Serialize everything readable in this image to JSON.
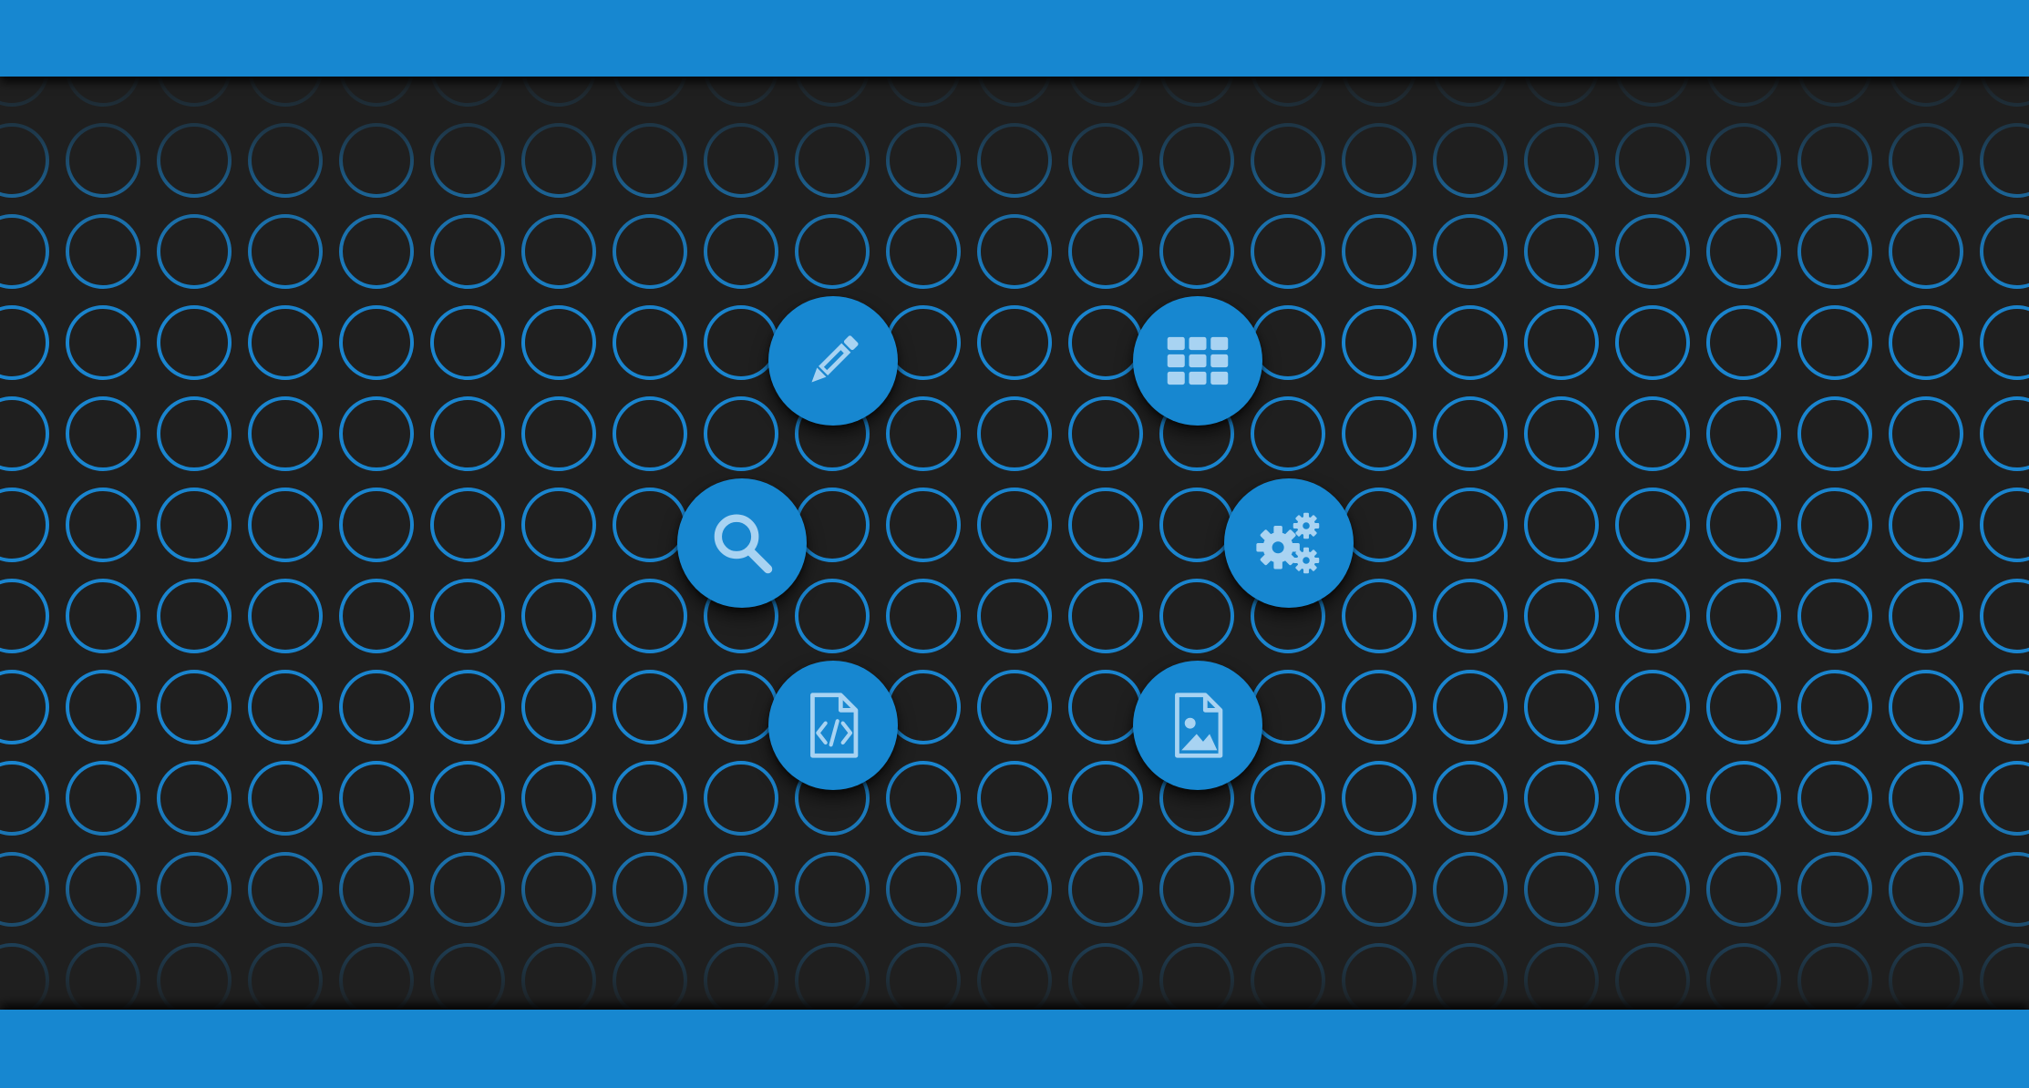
{
  "colors": {
    "accent": "#1787d0",
    "background": "#1f1f1f",
    "ring": "#1a85cf",
    "icon": "#a8d3f2"
  },
  "radial_menu": {
    "items": [
      {
        "icon": "pencil-icon",
        "action": "edit"
      },
      {
        "icon": "grid-icon",
        "action": "apps"
      },
      {
        "icon": "search-icon",
        "action": "search"
      },
      {
        "icon": "gears-icon",
        "action": "settings"
      },
      {
        "icon": "code-file-icon",
        "action": "code-file"
      },
      {
        "icon": "image-file-icon",
        "action": "image-file"
      }
    ]
  }
}
